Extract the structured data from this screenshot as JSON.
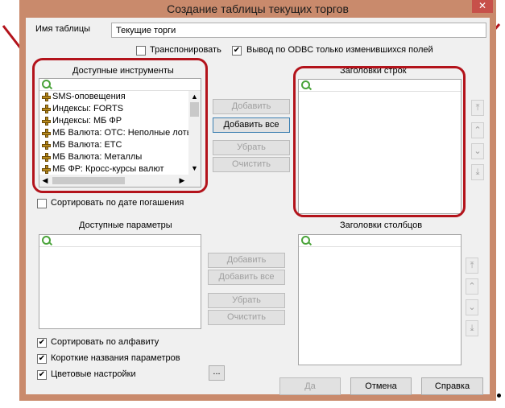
{
  "window": {
    "title": "Создание таблицы текущих торгов",
    "close_symbol": "✕"
  },
  "table_name": {
    "label": "Имя таблицы",
    "value": "Текущие торги"
  },
  "options": {
    "transpose_label": "Транспонировать",
    "transpose_checked": false,
    "odbc_label": "Вывод по ODBC только изменившихся  полей",
    "odbc_checked": true
  },
  "instruments": {
    "label": "Доступные инструменты",
    "items": [
      "SMS-оповещения",
      "Индексы: FORTS",
      "Индексы: МБ ФР",
      "МБ Валюта: ОТС: Неполные лоты",
      "МБ Валюта: ЕТС",
      "МБ Валюта: Металлы",
      "МБ ФР: Кросс-курсы валют"
    ],
    "sort_by_maturity_label": "Сортировать по дате погашения",
    "sort_by_maturity_checked": false
  },
  "instrument_buttons": {
    "add": "Добавить",
    "add_all": "Добавить все",
    "remove": "Убрать",
    "clear": "Очистить"
  },
  "row_headers": {
    "label": "Заголовки строк"
  },
  "parameters": {
    "label": "Доступные параметры"
  },
  "parameter_buttons": {
    "add": "Добавить",
    "add_all": "Добавить все",
    "remove": "Убрать",
    "clear": "Очистить"
  },
  "column_headers": {
    "label": "Заголовки столбцов"
  },
  "bottom_options": {
    "sort_alpha_label": "Сортировать по алфавиту",
    "sort_alpha_checked": true,
    "short_names_label": "Короткие названия параметров",
    "short_names_checked": true,
    "color_settings_label": "Цветовые настройки",
    "color_settings_checked": true,
    "ellipsis": "..."
  },
  "footer": {
    "ok": "Да",
    "cancel": "Отмена",
    "help": "Справка"
  },
  "move_buttons": {
    "top": "⤒",
    "up": "⌃",
    "down": "⌄",
    "bottom": "⤓"
  },
  "colors": {
    "highlight_frame": "#b3131b",
    "window_frame": "#c98a6c",
    "search_icon": "#4aa33a"
  }
}
